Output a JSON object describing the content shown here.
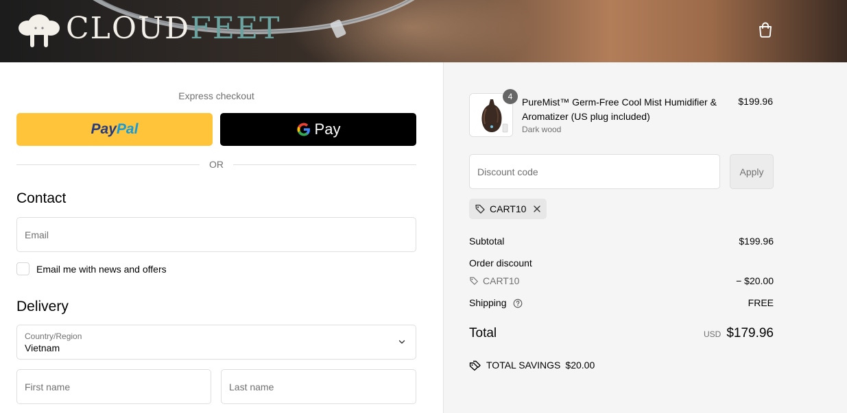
{
  "header": {
    "logo_part1": "CLOUD",
    "logo_part2": "FEET",
    "cart_icon": "shopping-bag-icon"
  },
  "express": {
    "title": "Express checkout",
    "paypal_label_1": "Pay",
    "paypal_label_2": "Pal",
    "gpay_g": "G",
    "gpay_label": "Pay",
    "or_label": "OR"
  },
  "contact": {
    "title": "Contact",
    "email_placeholder": "Email",
    "newsletter_label": "Email me with news and offers",
    "newsletter_checked": false
  },
  "delivery": {
    "title": "Delivery",
    "country_label": "Country/Region",
    "country_value": "Vietnam",
    "first_name_placeholder": "First name",
    "last_name_placeholder": "Last name"
  },
  "summary": {
    "product": {
      "name": "PureMist™ Germ-Free Cool Mist Humidifier & Aromatizer (US plug included)",
      "variant": "Dark wood",
      "quantity": "4",
      "price": "$199.96"
    },
    "discount_placeholder": "Discount code",
    "apply_label": "Apply",
    "applied_code": "CART10",
    "subtotal_label": "Subtotal",
    "subtotal_value": "$199.96",
    "order_discount_label": "Order discount",
    "discount_code": "CART10",
    "discount_value": "− $20.00",
    "shipping_label": "Shipping",
    "shipping_value": "FREE",
    "total_label": "Total",
    "currency": "USD",
    "total_value": "$179.96",
    "savings_label": "TOTAL SAVINGS",
    "savings_value": "$20.00"
  },
  "colors": {
    "paypal_yellow": "#ffc439",
    "paypal_dark_blue": "#253b80",
    "paypal_light_blue": "#179bd7",
    "gpay_black": "#000000",
    "summary_bg": "#f5f5f5",
    "logo_teal": "#6aa3a0"
  }
}
